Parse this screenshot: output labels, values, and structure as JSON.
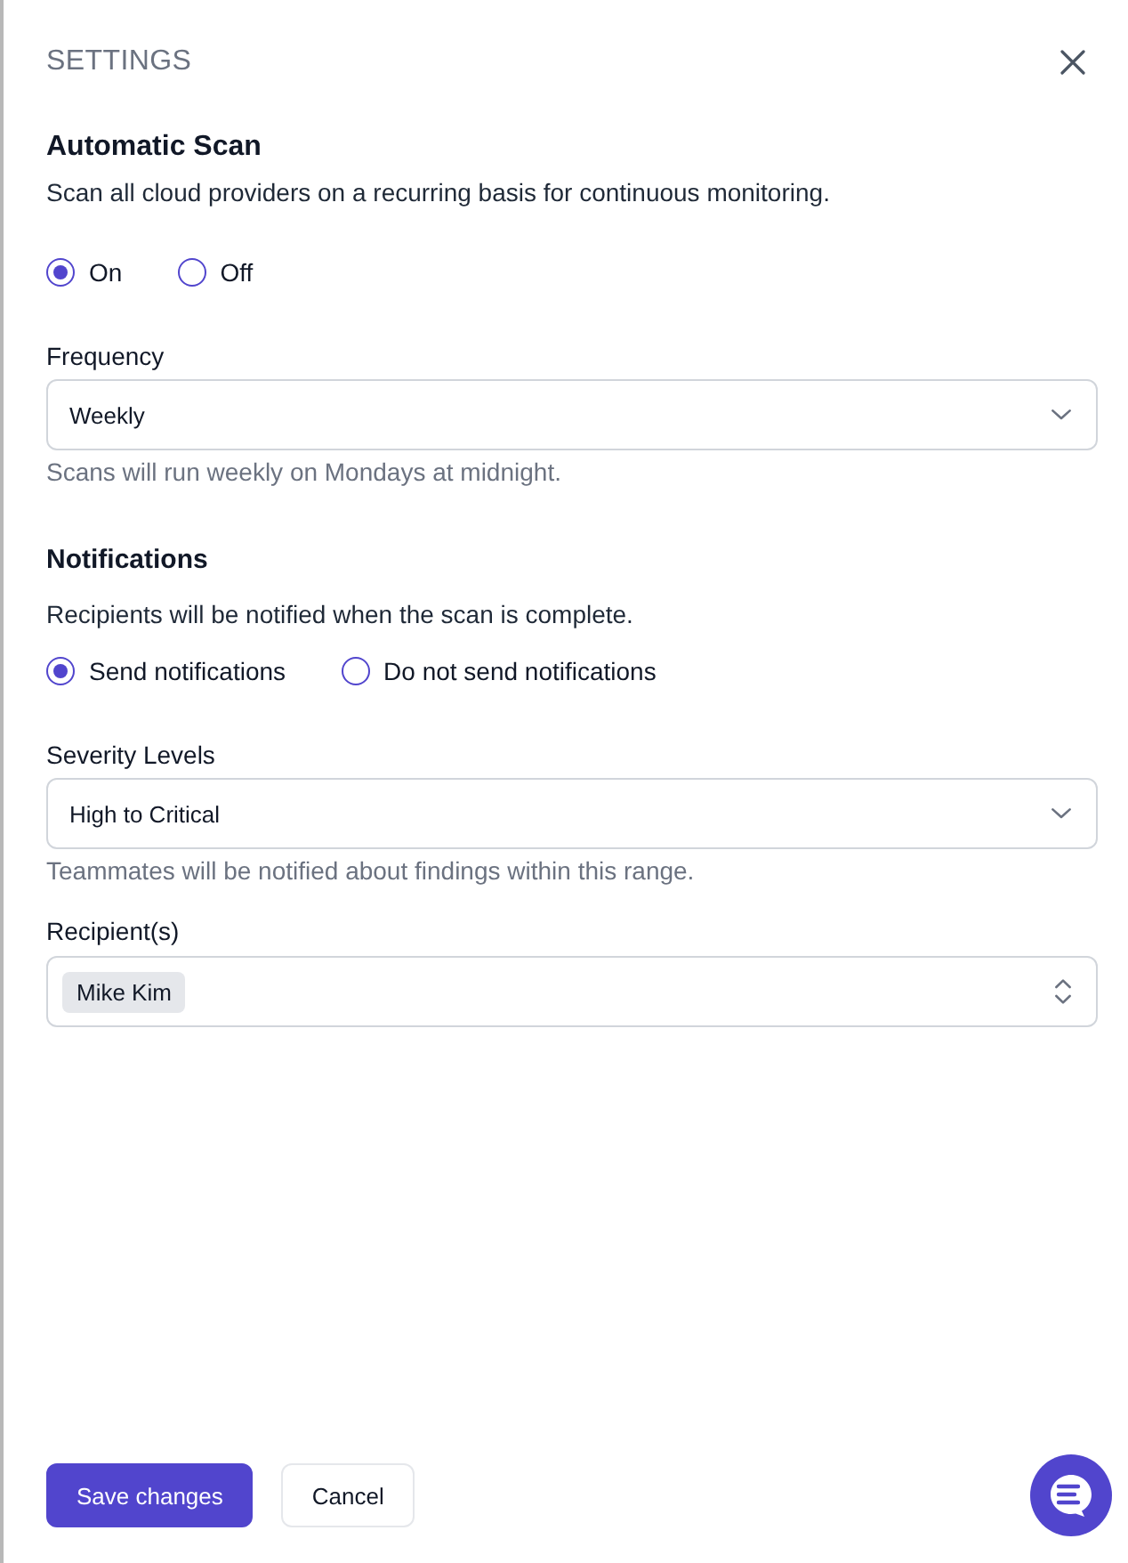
{
  "panel": {
    "title": "SETTINGS"
  },
  "automatic_scan": {
    "heading": "Automatic Scan",
    "description": "Scan all cloud providers on a recurring basis for continuous monitoring.",
    "options": [
      {
        "label": "On",
        "selected": true
      },
      {
        "label": "Off",
        "selected": false
      }
    ]
  },
  "frequency": {
    "label": "Frequency",
    "value": "Weekly",
    "help": "Scans will run weekly on Mondays at midnight."
  },
  "notifications": {
    "heading": "Notifications",
    "description": "Recipients will be notified when the scan is complete.",
    "options": [
      {
        "label": "Send notifications",
        "selected": true
      },
      {
        "label": "Do not send notifications",
        "selected": false
      }
    ]
  },
  "severity": {
    "label": "Severity Levels",
    "value": "High to Critical",
    "help": "Teammates will be notified about findings within this range."
  },
  "recipients": {
    "label": "Recipient(s)",
    "tags": [
      "Mike Kim"
    ]
  },
  "buttons": [
    {
      "label": "Save changes",
      "kind": "primary"
    },
    {
      "label": "Cancel",
      "kind": "secondary"
    }
  ]
}
